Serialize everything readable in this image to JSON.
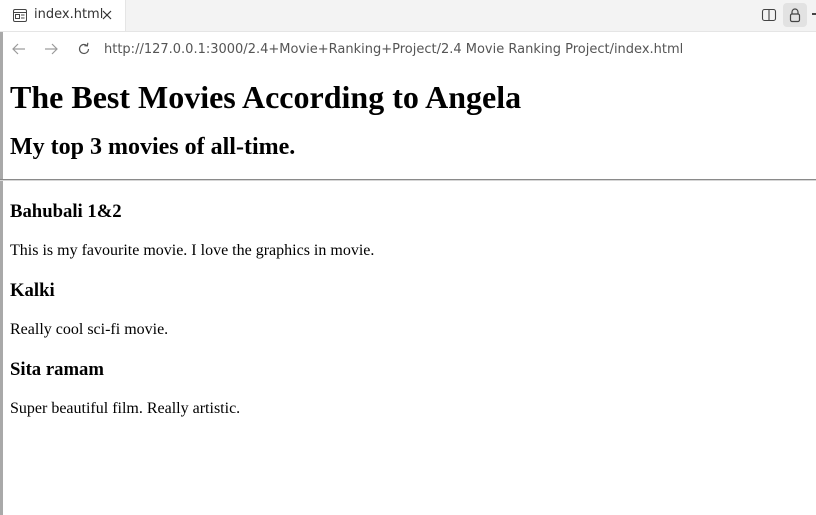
{
  "browser": {
    "tab": {
      "title": "index.html",
      "icon": "page-icon"
    },
    "address_bar": {
      "url": "http://127.0.0.1:3000/2.4+Movie+Ranking+Project/2.4 Movie Ranking Project/index.html"
    },
    "toolbar_icons": [
      "split-view-icon",
      "lock-icon"
    ]
  },
  "page": {
    "title": "The Best Movies According to Angela",
    "subtitle": "My top 3 movies of all-time.",
    "movies": [
      {
        "name": "Bahubali 1&2",
        "description": "This is my favourite movie. I love the graphics in movie."
      },
      {
        "name": "Kalki",
        "description": "Really cool sci-fi movie."
      },
      {
        "name": "Sita ramam",
        "description": "Super beautiful film. Really artistic."
      }
    ]
  }
}
